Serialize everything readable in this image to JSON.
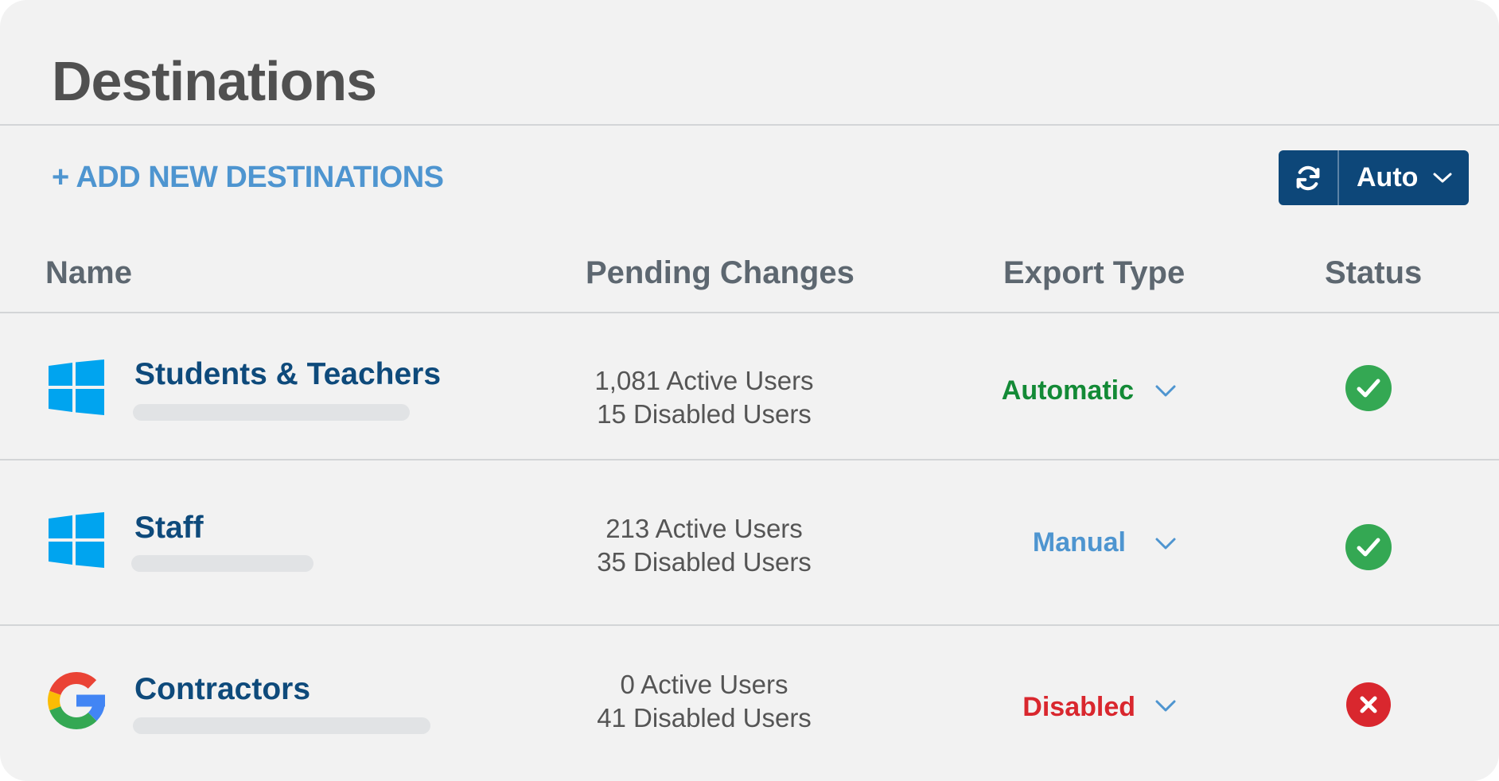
{
  "header": {
    "title": "Destinations"
  },
  "toolbar": {
    "add_label": "+ ADD NEW DESTINATIONS",
    "sync_icon": "refresh-icon",
    "mode_label": "Auto",
    "mode_icon": "chevron-down-icon"
  },
  "table": {
    "columns": [
      "Name",
      "Pending Changes",
      "Export Type",
      "Status"
    ],
    "rows": [
      {
        "provider_icon": "windows-logo-icon",
        "name": "Students & Teachers",
        "active": "1,081 Active Users",
        "disabled": "15 Disabled Users",
        "export_type": "Automatic",
        "export_color": "#138a36",
        "status_icon": "check-circle-icon",
        "status_color": "#34a853"
      },
      {
        "provider_icon": "windows-logo-icon",
        "name": "Staff",
        "active": "213 Active Users",
        "disabled": "35 Disabled Users",
        "export_type": "Manual",
        "export_color": "#4e95d0",
        "status_icon": "check-circle-icon",
        "status_color": "#34a853"
      },
      {
        "provider_icon": "google-logo-icon",
        "name": "Contractors",
        "active": "0 Active Users",
        "disabled": "41 Disabled Users",
        "export_type": "Disabled",
        "export_color": "#d9272e",
        "status_icon": "x-circle-icon",
        "status_color": "#d9272e"
      }
    ]
  },
  "colors": {
    "brand_navy": "#0d4779",
    "link_blue": "#4e95d0",
    "windows_blue": "#00a4ef"
  }
}
